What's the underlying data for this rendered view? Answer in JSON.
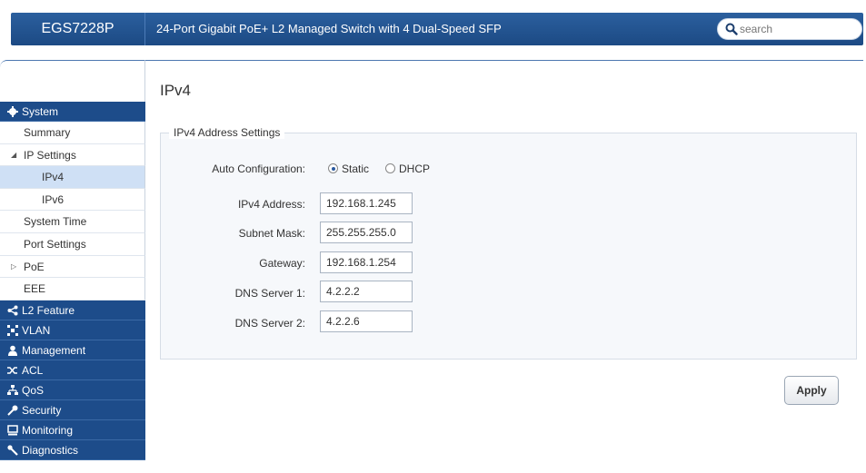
{
  "header": {
    "model": "EGS7228P",
    "description": "24-Port Gigabit PoE+ L2 Managed Switch with 4 Dual-Speed SFP",
    "search_placeholder": "search"
  },
  "sidebar": {
    "system": {
      "label": "System",
      "icon": "gear-icon",
      "items": {
        "summary": "Summary",
        "ip_settings": "IP Settings",
        "ipv4": "IPv4",
        "ipv6": "IPv6",
        "system_time": "System Time",
        "port_settings": "Port Settings",
        "poe": "PoE",
        "eee": "EEE"
      }
    },
    "sections": {
      "l2_feature": "L2 Feature",
      "vlan": "VLAN",
      "management": "Management",
      "acl": "ACL",
      "qos": "QoS",
      "security": "Security",
      "monitoring": "Monitoring",
      "diagnostics": "Diagnostics"
    }
  },
  "main": {
    "title": "IPv4",
    "fieldset_legend": "IPv4 Address Settings",
    "auto_config": {
      "label": "Auto Configuration:",
      "options": [
        "Static",
        "DHCP"
      ],
      "selected": "Static"
    },
    "fields": {
      "ipv4_address": {
        "label": "IPv4 Address:",
        "value": "192.168.1.245"
      },
      "subnet_mask": {
        "label": "Subnet Mask:",
        "value": "255.255.255.0"
      },
      "gateway": {
        "label": "Gateway:",
        "value": "192.168.1.254"
      },
      "dns1": {
        "label": "DNS Server 1:",
        "value": "4.2.2.2"
      },
      "dns2": {
        "label": "DNS Server 2:",
        "value": "4.2.2.6"
      }
    },
    "apply_label": "Apply"
  },
  "colors": {
    "header_blue": "#1d4c8a",
    "active_item": "#cfe0f5"
  }
}
